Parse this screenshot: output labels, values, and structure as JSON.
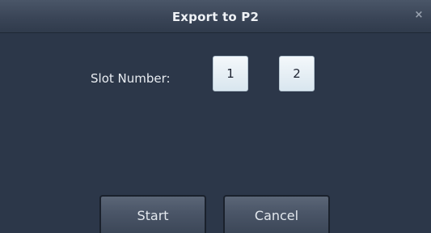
{
  "dialog": {
    "title": "Export to P2",
    "close_glyph": "×",
    "slot_label": "Slot Number:",
    "slots": [
      "1",
      "2"
    ],
    "buttons": {
      "start": "Start",
      "cancel": "Cancel"
    }
  },
  "colors": {
    "background": "#2c3749",
    "titlebar": "#3a4557",
    "slot_button": "#e6eff5",
    "action_button": "#4a5567"
  }
}
